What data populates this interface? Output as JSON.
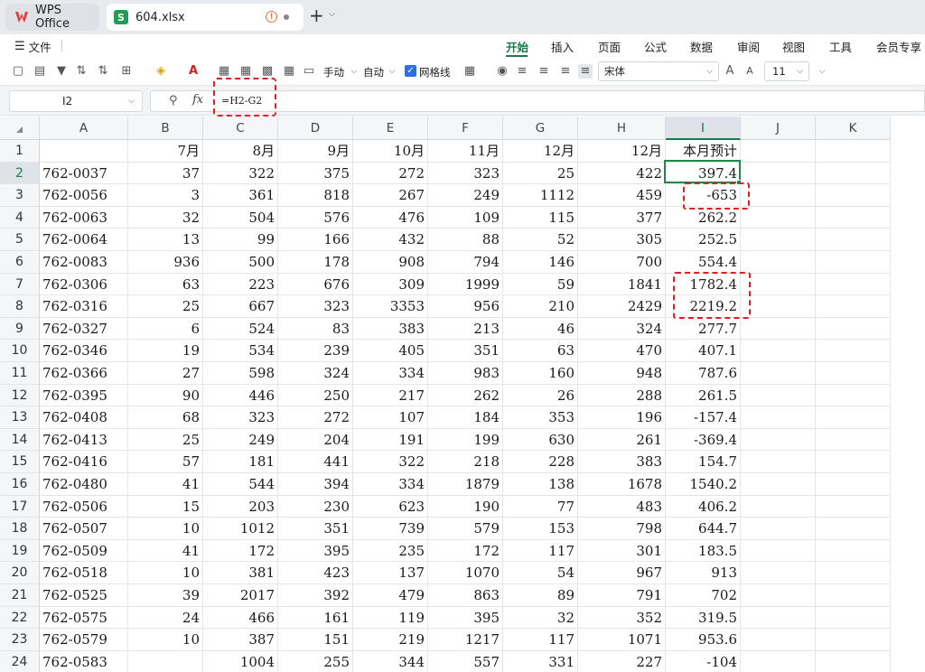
{
  "tabs": {
    "app": "WPS Office",
    "file": "604.xlsx"
  },
  "menu": {
    "file": "文件",
    "ribbon_tabs": [
      "开始",
      "插入",
      "页面",
      "公式",
      "数据",
      "审阅",
      "视图",
      "工具",
      "会员专享"
    ]
  },
  "toolbar": {
    "manual": "手动",
    "auto": "自动",
    "gridlines": "网格线",
    "gridlines_checked": true,
    "font_name": "宋体",
    "font_size": "11"
  },
  "formula_bar": {
    "cell_ref": "I2",
    "formula": "=H2-G2"
  },
  "columns": [
    "A",
    "B",
    "C",
    "D",
    "E",
    "F",
    "G",
    "H",
    "I",
    "J",
    "K"
  ],
  "rows": [
    {
      "n": "1",
      "cells": [
        "",
        "7月",
        "8月",
        "9月",
        "10月",
        "11月",
        "12月",
        "12月",
        "本月预计"
      ]
    },
    {
      "n": "2",
      "cells": [
        "762-0037",
        "37",
        "322",
        "375",
        "272",
        "323",
        "25",
        "422",
        "397.4"
      ]
    },
    {
      "n": "3",
      "cells": [
        "762-0056",
        "3",
        "361",
        "818",
        "267",
        "249",
        "1112",
        "459",
        "-653"
      ]
    },
    {
      "n": "4",
      "cells": [
        "762-0063",
        "32",
        "504",
        "576",
        "476",
        "109",
        "115",
        "377",
        "262.2"
      ]
    },
    {
      "n": "5",
      "cells": [
        "762-0064",
        "13",
        "99",
        "166",
        "432",
        "88",
        "52",
        "305",
        "252.5"
      ]
    },
    {
      "n": "6",
      "cells": [
        "762-0083",
        "936",
        "500",
        "178",
        "908",
        "794",
        "146",
        "700",
        "554.4"
      ]
    },
    {
      "n": "7",
      "cells": [
        "762-0306",
        "63",
        "223",
        "676",
        "309",
        "1999",
        "59",
        "1841",
        "1782.4"
      ]
    },
    {
      "n": "8",
      "cells": [
        "762-0316",
        "25",
        "667",
        "323",
        "3353",
        "956",
        "210",
        "2429",
        "2219.2"
      ]
    },
    {
      "n": "9",
      "cells": [
        "762-0327",
        "6",
        "524",
        "83",
        "383",
        "213",
        "46",
        "324",
        "277.7"
      ]
    },
    {
      "n": "10",
      "cells": [
        "762-0346",
        "19",
        "534",
        "239",
        "405",
        "351",
        "63",
        "470",
        "407.1"
      ]
    },
    {
      "n": "11",
      "cells": [
        "762-0366",
        "27",
        "598",
        "324",
        "334",
        "983",
        "160",
        "948",
        "787.6"
      ]
    },
    {
      "n": "12",
      "cells": [
        "762-0395",
        "90",
        "446",
        "250",
        "217",
        "262",
        "26",
        "288",
        "261.5"
      ]
    },
    {
      "n": "13",
      "cells": [
        "762-0408",
        "68",
        "323",
        "272",
        "107",
        "184",
        "353",
        "196",
        "-157.4"
      ]
    },
    {
      "n": "14",
      "cells": [
        "762-0413",
        "25",
        "249",
        "204",
        "191",
        "199",
        "630",
        "261",
        "-369.4"
      ]
    },
    {
      "n": "15",
      "cells": [
        "762-0416",
        "57",
        "181",
        "441",
        "322",
        "218",
        "228",
        "383",
        "154.7"
      ]
    },
    {
      "n": "16",
      "cells": [
        "762-0480",
        "41",
        "544",
        "394",
        "334",
        "1879",
        "138",
        "1678",
        "1540.2"
      ]
    },
    {
      "n": "17",
      "cells": [
        "762-0506",
        "15",
        "203",
        "230",
        "623",
        "190",
        "77",
        "483",
        "406.2"
      ]
    },
    {
      "n": "18",
      "cells": [
        "762-0507",
        "10",
        "1012",
        "351",
        "739",
        "579",
        "153",
        "798",
        "644.7"
      ]
    },
    {
      "n": "19",
      "cells": [
        "762-0509",
        "41",
        "172",
        "395",
        "235",
        "172",
        "117",
        "301",
        "183.5"
      ]
    },
    {
      "n": "20",
      "cells": [
        "762-0518",
        "10",
        "381",
        "423",
        "137",
        "1070",
        "54",
        "967",
        "913"
      ]
    },
    {
      "n": "21",
      "cells": [
        "762-0525",
        "39",
        "2017",
        "392",
        "479",
        "863",
        "89",
        "791",
        "702"
      ]
    },
    {
      "n": "22",
      "cells": [
        "762-0575",
        "24",
        "466",
        "161",
        "119",
        "395",
        "32",
        "352",
        "319.5"
      ]
    },
    {
      "n": "23",
      "cells": [
        "762-0579",
        "10",
        "387",
        "151",
        "219",
        "1217",
        "117",
        "1071",
        "953.6"
      ]
    },
    {
      "n": "24",
      "cells": [
        "762-0583",
        "",
        "1004",
        "255",
        "344",
        "557",
        "331",
        "227",
        "-104"
      ]
    }
  ]
}
